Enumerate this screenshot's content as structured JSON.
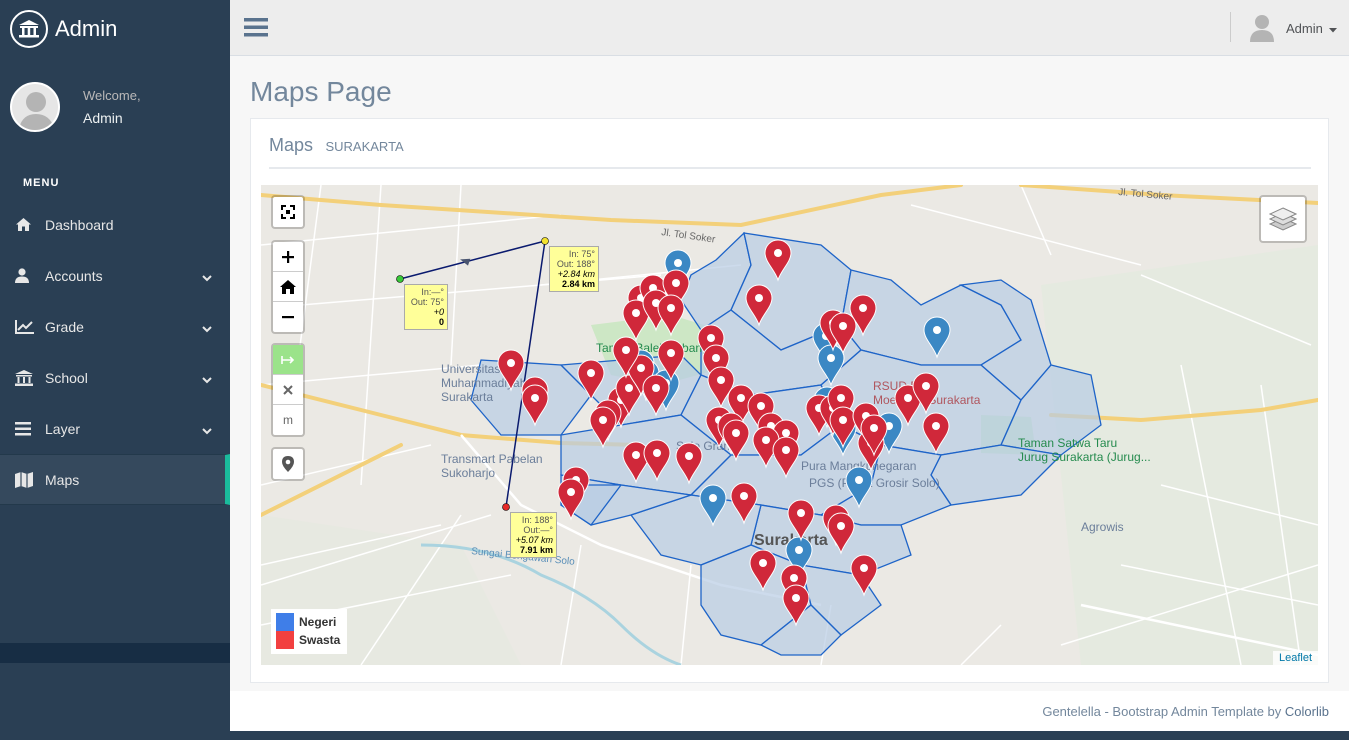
{
  "sidebar": {
    "brand": "Admin",
    "welcome": "Welcome,",
    "user": "Admin",
    "menu_title": "MENU",
    "items": [
      {
        "label": "Dashboard",
        "icon": "home-icon"
      },
      {
        "label": "Accounts",
        "icon": "user-icon"
      },
      {
        "label": "Grade",
        "icon": "chart-icon"
      },
      {
        "label": "School",
        "icon": "bank-icon"
      },
      {
        "label": "Layer",
        "icon": "bars-icon"
      },
      {
        "label": "Maps",
        "icon": "map-icon"
      }
    ],
    "active_item": "Maps"
  },
  "topbar": {
    "user": "Admin"
  },
  "main": {
    "page_title": "Maps Page",
    "panel_title": "Maps",
    "panel_subtitle": "SURAKARTA"
  },
  "map": {
    "labels": {
      "tol1": "Jl. Tol Soker",
      "tol2": "Jl. Tol Soker",
      "taman": "Taman Balekambang",
      "rsud1": "RSUD Dr.",
      "rsud2": "Moewardi Surakarta",
      "satwa1": "Taman Satwa Taru",
      "satwa2": "Jurug Surakarta (Jurug...",
      "univ1": "Universitas",
      "univ2": "Muhammadiyah",
      "univ3": "Surakarta",
      "transmart1": "Transmart Pabelan",
      "transmart2": "Sukoharjo",
      "sungai": "Sungai Bengawan Solo",
      "surakarta": "Surakarta",
      "agrowis": "Agrowis",
      "pgs": "Pura Mangkunegaran",
      "pgs2": "PGS (Pusat Grosir Solo)",
      "solo": "Solo Grand"
    },
    "measure": {
      "tip1": {
        "l1": "In:—°",
        "l2": "Out: 75°",
        "l3": "+0",
        "l4": "0"
      },
      "tip2": {
        "l1": "In: 75°",
        "l2": "Out: 188°",
        "l3": "+2.84 km",
        "l4": "2.84 km"
      },
      "tip3": {
        "l1": "In: 188°",
        "l2": "Out:—°",
        "l3": "+5.07 km",
        "l4": "7.91 km"
      }
    },
    "legend": [
      {
        "label": "Negeri",
        "color": "#3F7EE8"
      },
      {
        "label": "Swasta",
        "color": "#F24040"
      }
    ],
    "attribution": "Leaflet",
    "controls": {
      "measure_unit": "m"
    }
  },
  "footer": {
    "text": "Gentelella - Bootstrap Admin Template by",
    "link": "Colorlib"
  },
  "colors": {
    "sidebar": "#2A3F54",
    "accent": "#1ABB9C",
    "marker_private": "#D0283A",
    "marker_public": "#3B88C4",
    "district_fill": "#B8CCE4",
    "district_line": "#1E64C8"
  }
}
